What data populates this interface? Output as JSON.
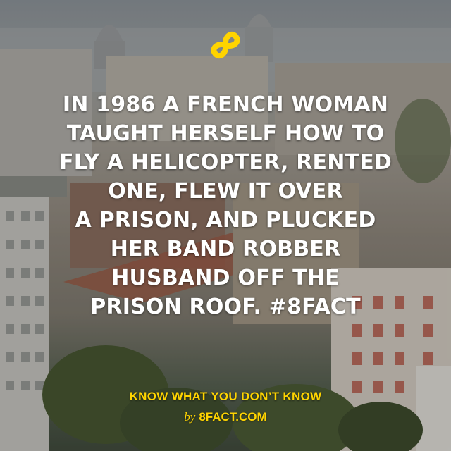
{
  "colors": {
    "accent": "#ffd400",
    "text": "#ffffff"
  },
  "logo": {
    "icon": "infinity-eight-icon"
  },
  "fact": {
    "lines": [
      "IN 1986 A FRENCH WOMAN",
      "TAUGHT HERSELF HOW TO",
      "FLY A HELICOPTER, RENTED",
      "ONE, FLEW IT OVER",
      "A PRISON, AND PLUCKED",
      "HER BAND ROBBER",
      "HUSBAND OFF THE",
      "PRISON ROOF. #8FACT"
    ]
  },
  "footer": {
    "tagline": "KNOW WHAT YOU DON’T KNOW",
    "by": "by",
    "site": "8FACT.COM"
  }
}
